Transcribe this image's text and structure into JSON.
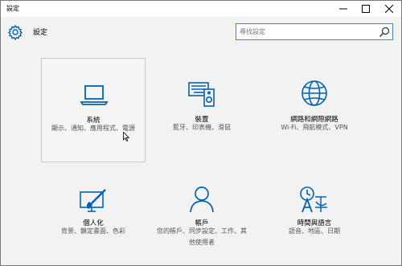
{
  "window": {
    "title": "設定"
  },
  "header": {
    "label": "設定",
    "search_placeholder": "尋找設定"
  },
  "tiles": [
    {
      "name": "系統",
      "desc": "顯示、通知、應用程式、電源"
    },
    {
      "name": "裝置",
      "desc": "藍牙、印表機、滑鼠"
    },
    {
      "name": "網路和網際網路",
      "desc": "Wi-Fi、飛航模式、VPN"
    },
    {
      "name": "個人化",
      "desc": "背景、鎖定畫面、色彩"
    },
    {
      "name": "帳戶",
      "desc": "您的帳戶、同步設定、工作、其他使用者"
    },
    {
      "name": "時間與語言",
      "desc": "語音、地區、日期"
    }
  ],
  "colors": {
    "accent": "#0063b1",
    "window_bg": "#f2f2f2",
    "search_border": "#4a7fc0"
  },
  "icons": [
    "gear-icon",
    "search-icon",
    "minimize-icon",
    "maximize-icon",
    "close-icon",
    "laptop-icon",
    "keyboard-speaker-icon",
    "globe-icon",
    "paint-brush-icon",
    "person-icon",
    "time-language-icon"
  ]
}
